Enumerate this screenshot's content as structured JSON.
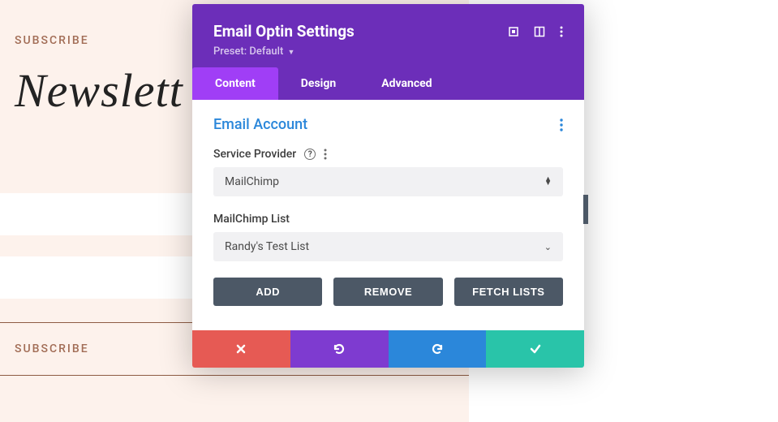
{
  "background": {
    "subscribe_label": "SUBSCRIBE",
    "newsletter_title": "Newslett",
    "subscribe_btn": "SUBSCRIBE"
  },
  "modal": {
    "title": "Email Optin Settings",
    "preset_label": "Preset: Default",
    "tabs": {
      "content": "Content",
      "design": "Design",
      "advanced": "Advanced"
    },
    "section": {
      "title": "Email Account"
    },
    "fields": {
      "service_provider_label": "Service Provider",
      "service_provider_value": "MailChimp",
      "list_label": "MailChimp List",
      "list_value": "Randy's Test List"
    },
    "buttons": {
      "add": "ADD",
      "remove": "REMOVE",
      "fetch": "FETCH LISTS"
    }
  }
}
